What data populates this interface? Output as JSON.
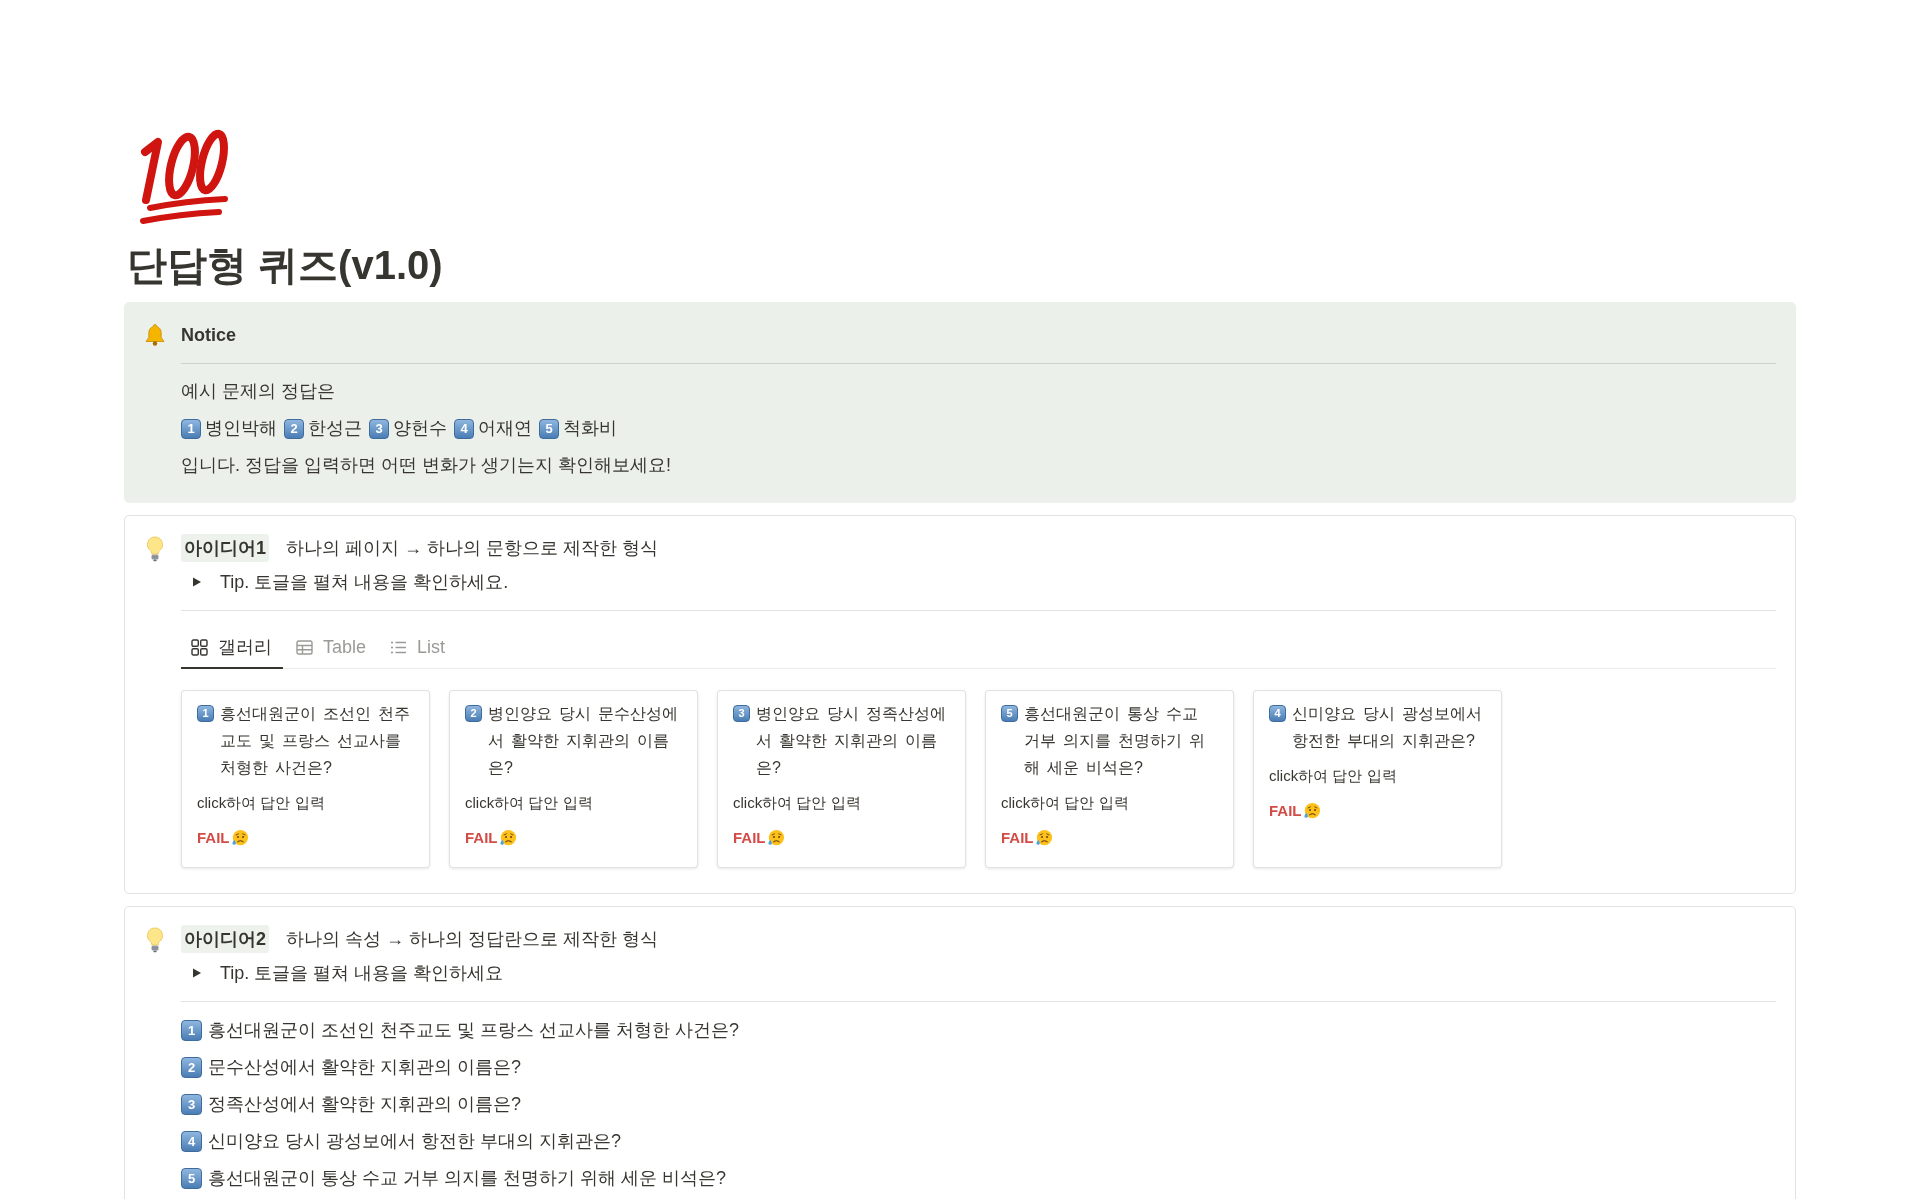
{
  "page": {
    "title": "단답형 퀴즈(v1.0)"
  },
  "notice": {
    "title": "Notice",
    "intro": "예시 문제의 정답은",
    "answers": [
      {
        "number": "1",
        "text": "병인박해"
      },
      {
        "number": "2",
        "text": "한성근"
      },
      {
        "number": "3",
        "text": "양헌수"
      },
      {
        "number": "4",
        "text": "어재연"
      },
      {
        "number": "5",
        "text": "척화비"
      }
    ],
    "outro": "입니다. 정답을 입력하면 어떤 변화가 생기는지 확인해보세요!"
  },
  "ideas": [
    {
      "kind": "gallery",
      "label": "아이디어1",
      "description": "하나의 페이지 → 하나의 문항으로 제작한 형식",
      "toggle": {
        "text": "Tip. 토글을 펼쳐 내용을 확인하세요.",
        "expanded": false
      },
      "views": [
        {
          "kind": "gallery",
          "label": "갤러리",
          "selected": true
        },
        {
          "kind": "table",
          "label": "Table",
          "selected": false
        },
        {
          "kind": "list",
          "label": "List",
          "selected": false
        }
      ],
      "cards": [
        {
          "number": "1",
          "question": "흥선대원군이 조선인 천주교도 및 프랑스 선교사를 처형한 사건은?",
          "answer": "click하여 답안 입력",
          "result": {
            "label": "FAIL",
            "passed": false
          }
        },
        {
          "number": "2",
          "question": "병인양요 당시 문수산성에서 활약한 지휘관의 이름은?",
          "answer": "click하여 답안 입력",
          "result": {
            "label": "FAIL",
            "passed": false
          }
        },
        {
          "number": "3",
          "question": "병인양요 당시 정족산성에서 활약한 지휘관의 이름은?",
          "answer": "click하여 답안 입력",
          "result": {
            "label": "FAIL",
            "passed": false
          }
        },
        {
          "number": "5",
          "question": "흥선대원군이 통상 수교 거부 의지를 천명하기 위해 세운 비석은?",
          "answer": "click하여 답안 입력",
          "result": {
            "label": "FAIL",
            "passed": false
          }
        },
        {
          "number": "4",
          "question": "신미양요 당시 광성보에서 항전한 부대의 지휘관은?",
          "answer": "click하여 답안 입력",
          "result": {
            "label": "FAIL",
            "passed": false
          }
        }
      ]
    },
    {
      "kind": "questions",
      "label": "아이디어2",
      "description": "하나의 속성 → 하나의 정답란으로 제작한 형식",
      "toggle": {
        "text": "Tip. 토글을 펼쳐 내용을 확인하세요",
        "expanded": false
      },
      "questions": [
        {
          "number": "1",
          "text": "흥선대원군이 조선인 천주교도 및 프랑스 선교사를 처형한 사건은?"
        },
        {
          "number": "2",
          "text": "문수산성에서 활약한 지휘관의 이름은?"
        },
        {
          "number": "3",
          "text": "정족산성에서 활약한 지휘관의 이름은?"
        },
        {
          "number": "4",
          "text": "신미양요 당시 광성보에서 항전한 부대의 지휘관은?"
        },
        {
          "number": "5",
          "text": "흥선대원군이 통상 수교 거부 의지를 천명하기 위해 세운 비석은?"
        }
      ]
    }
  ]
}
